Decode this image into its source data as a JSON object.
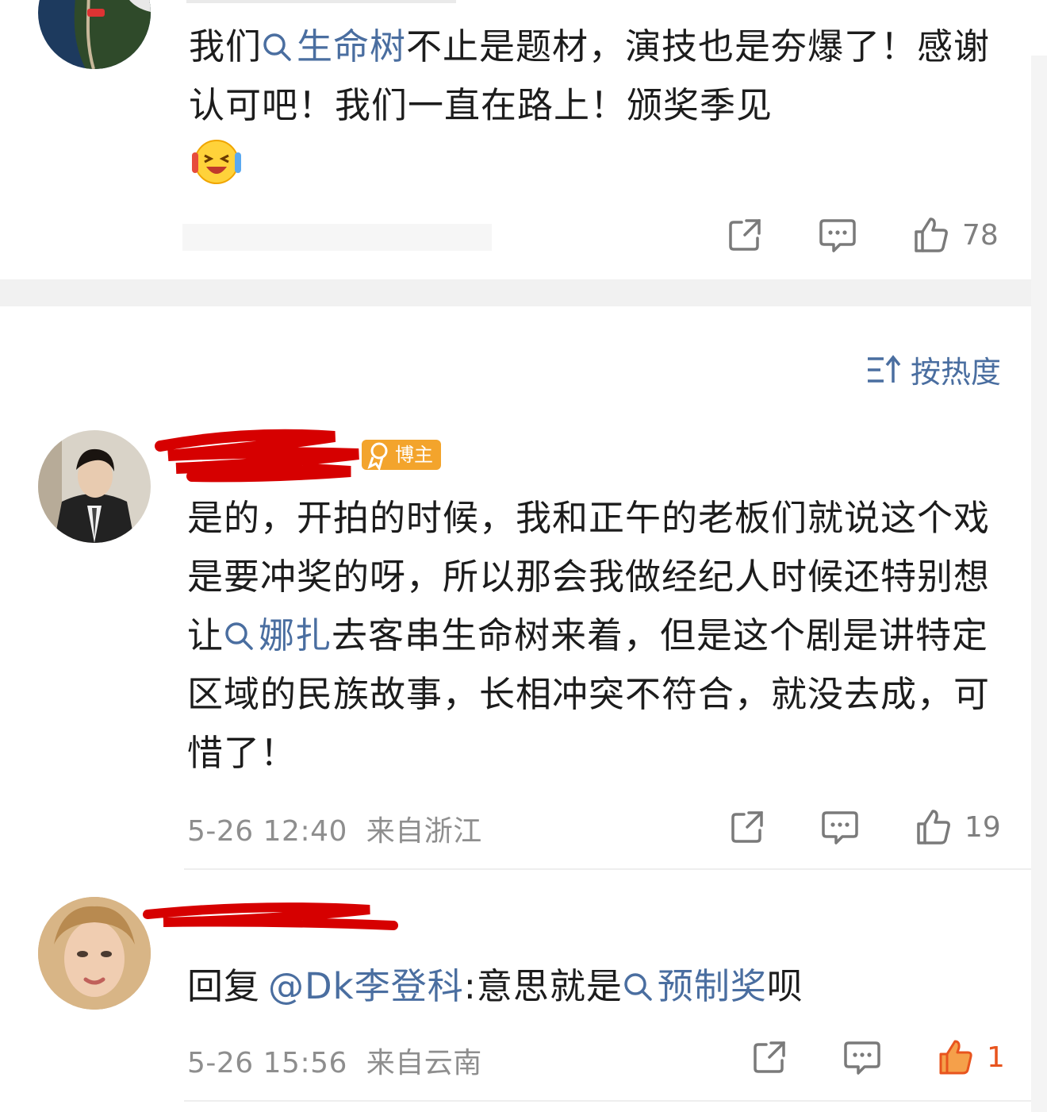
{
  "comments": [
    {
      "text_before": "我们",
      "topic": "生命树",
      "text_after": "不止是题材，演技也是夯爆了！感谢认可吧！我们一直在路上！颁奖季见",
      "emoji": "laughing-crying-emoji",
      "likes": "78"
    },
    {
      "badge": "博主",
      "text_a": "是的，开拍的时候，我和正午的老板们就说这个戏是要冲奖的呀，所以那会我做经纪人时候还特别想让",
      "topic": "娜扎",
      "text_b": "去客串生命树来着，但是这个剧是讲特定区域的民族故事，长相冲突不符合，就没去成，可惜了！",
      "timestamp": "5-26 12:40",
      "location": "来自浙江",
      "likes": "19"
    },
    {
      "reply_prefix": "回复",
      "mention": "@Dk李登科",
      "text": ":意思就是",
      "topic": "预制奖",
      "text_after": "呗",
      "timestamp": "5-26 15:56",
      "location": "来自云南",
      "likes": "1"
    }
  ],
  "sort": {
    "label": "按热度"
  },
  "colors": {
    "link": "#4a6ea0",
    "liked": "#e8541e",
    "badge": "#f3a42c",
    "redaction": "#d60000"
  }
}
